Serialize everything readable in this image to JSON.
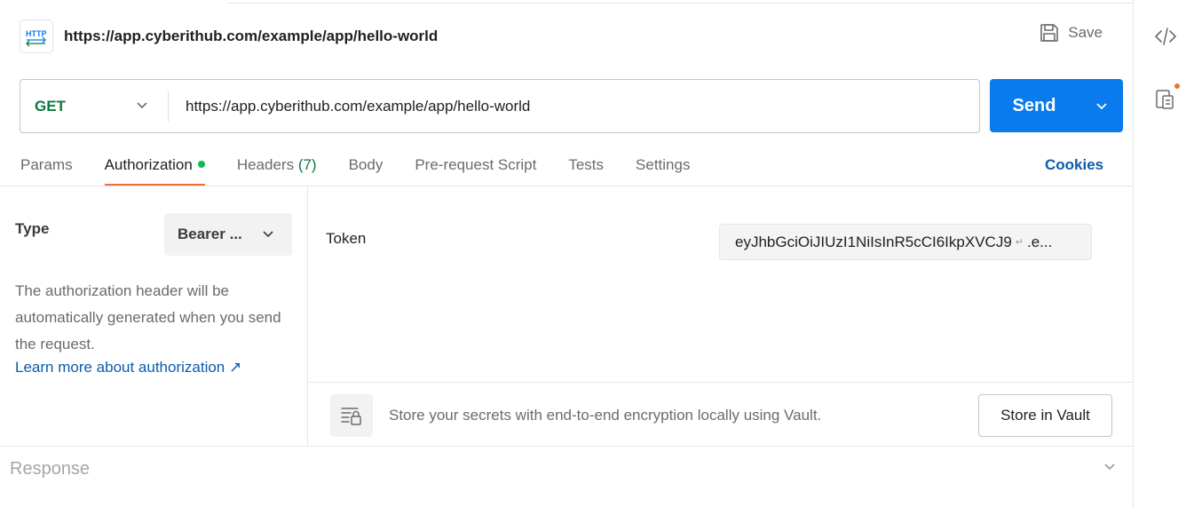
{
  "request": {
    "title": "https://app.cyberithub.com/example/app/hello-world",
    "save_label": "Save",
    "method": "GET",
    "url": "https://app.cyberithub.com/example/app/hello-world",
    "send_label": "Send"
  },
  "tabs": [
    {
      "label": "Params"
    },
    {
      "label": "Authorization",
      "active": true,
      "indicator": "green-dot"
    },
    {
      "label": "Headers",
      "count": "(7)"
    },
    {
      "label": "Body"
    },
    {
      "label": "Pre-request Script"
    },
    {
      "label": "Tests"
    },
    {
      "label": "Settings"
    }
  ],
  "cookies_label": "Cookies",
  "auth": {
    "type_label": "Type",
    "type_value": "Bearer ...",
    "description": "The authorization header will be automatically generated when you send the request.",
    "learn_more": "Learn more about authorization ↗",
    "token_label": "Token",
    "token_value": "eyJhbGciOiJIUzI1NiIsInR5cCI6IkpXVCJ9",
    "token_line_break": "↵",
    "token_rest": ".e..."
  },
  "vault": {
    "message": "Store your secrets with end-to-end encryption locally using Vault.",
    "button_label": "Store in Vault"
  },
  "response": {
    "label": "Response"
  },
  "colors": {
    "accent_blue": "#097bed",
    "link_blue": "#0b5cad",
    "method_green": "#0b7a3e",
    "active_tab_underline": "#f26b3a",
    "status_dot_green": "#0cbb52",
    "notification_dot": "#f26b3a"
  },
  "icons": {
    "http": "http-icon",
    "save": "floppy-disk-icon",
    "code": "code-icon",
    "docs": "documentation-icon",
    "vault": "vault-lock-icon"
  }
}
